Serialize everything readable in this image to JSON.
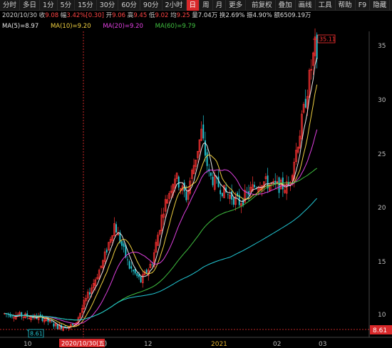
{
  "toolbar": {
    "items": [
      {
        "label": "分时",
        "active": false
      },
      {
        "label": "多日",
        "active": false
      },
      {
        "label": "1分",
        "active": false
      },
      {
        "label": "5分",
        "active": false
      },
      {
        "label": "15分",
        "active": false
      },
      {
        "label": "30分",
        "active": false
      },
      {
        "label": "60分",
        "active": false
      },
      {
        "label": "90分",
        "active": false
      },
      {
        "label": "2小时",
        "active": false
      },
      {
        "label": "日",
        "active": true
      },
      {
        "label": "周",
        "active": false
      },
      {
        "label": "月",
        "active": false
      },
      {
        "label": "更多",
        "active": false
      }
    ],
    "right_items": [
      "前复权",
      "叠加",
      "画线",
      "工具",
      "帮助",
      "F9",
      "隐藏"
    ]
  },
  "info": {
    "date": "2020/10/30",
    "close_label": "收",
    "close": "9.08",
    "change_label": "幅",
    "change": "3.42%[0.30]",
    "open_label": "开",
    "open": "9.06",
    "high_label": "高",
    "high": "9.45",
    "low_label": "低",
    "low": "9.02",
    "avg_label": "均",
    "avg": "9.25",
    "volume_label": "量",
    "volume": "7.04万",
    "turnover_label": "换",
    "turnover": "2.69%",
    "amplitude_label": "振",
    "amplitude": "4.90%",
    "amount_label": "额",
    "amount": "6509.19万"
  },
  "ma": [
    {
      "label": "MA(5)=8.97",
      "color": "#e8e8e8"
    },
    {
      "label": "MA(10)=9.20",
      "color": "#f0d040"
    },
    {
      "label": "MA(20)=9.20",
      "color": "#e040e0"
    },
    {
      "label": "MA(60)=9.79",
      "color": "#40c040"
    }
  ],
  "axis": {
    "y_ticks": [
      "35",
      "30",
      "25",
      "20",
      "15",
      "10"
    ],
    "x_ticks": [
      "10",
      "12",
      "2021",
      "02",
      "03"
    ],
    "crosshair_date": "2020/10/30(五)",
    "crosshair_price": "8.61",
    "max_label": "35.11",
    "min_label": "8.61"
  },
  "colors": {
    "up": "#ff3333",
    "down": "#22c9d6",
    "ma5": "#e8e8e8",
    "ma10": "#f0d040",
    "ma20": "#e040e0",
    "ma60": "#40c040",
    "ma_long": "#22c9d6"
  }
}
